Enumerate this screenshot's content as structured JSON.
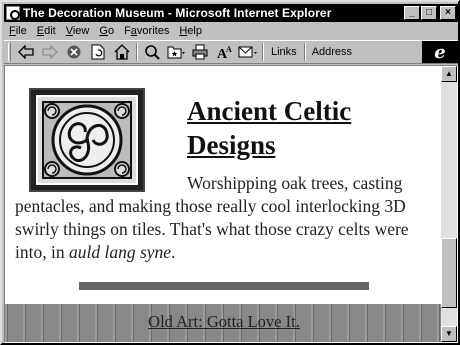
{
  "window": {
    "title": "The Decoration Museum - Microsoft Internet Explorer",
    "minimize_label": "_",
    "maximize_label": "□",
    "close_label": "×"
  },
  "menubar": {
    "items": [
      {
        "ul": "F",
        "rest": "ile"
      },
      {
        "ul": "E",
        "rest": "dit"
      },
      {
        "ul": "V",
        "rest": "iew"
      },
      {
        "ul": "G",
        "rest": "o"
      },
      {
        "ul": "",
        "pre": "F",
        "ul2": "a",
        "rest": "vorites"
      },
      {
        "ul": "H",
        "rest": "elp"
      }
    ]
  },
  "toolbar": {
    "links_label": "Links",
    "address_label": "Address",
    "logo_letter": "e"
  },
  "page": {
    "heading": "Ancient Celtic Designs",
    "body_text": "Worshipping oak trees, casting pentacles, and making those really cool interlocking 3D swirly things on tiles. That's what those crazy celts were into, in ",
    "body_em": "auld lang syne",
    "body_end": ".",
    "footer_link": "Old Art: Gotta Love It."
  },
  "colors": {
    "titlebar": "#000000",
    "chrome": "#c0c0c0",
    "page_bg": "#ffffff",
    "footer_band": "#808080"
  }
}
